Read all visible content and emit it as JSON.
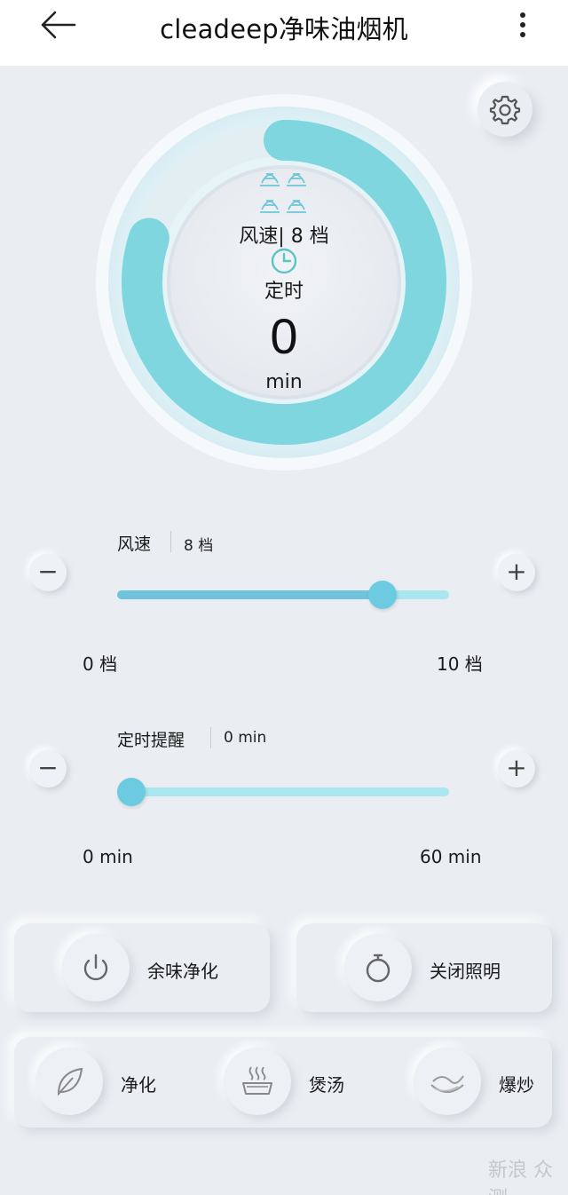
{
  "header": {
    "title": "cleadeep净味油烟机"
  },
  "dial": {
    "speed_text": "风速| 8 档",
    "timer_label": "定时",
    "timer_value": "0",
    "timer_unit": "min",
    "ring_progress": 0.8
  },
  "fan_speed": {
    "label": "风速",
    "value_text": "8 档",
    "value": 8,
    "min": 0,
    "max": 10,
    "min_label": "0 档",
    "max_label": "10 档",
    "minus": "−",
    "plus": "+"
  },
  "timer": {
    "label": "定时提醒",
    "value_text": "0 min",
    "value": 0,
    "min": 0,
    "max": 60,
    "min_label": "0 min",
    "max_label": "60 min",
    "minus": "−",
    "plus": "+"
  },
  "actions": {
    "residual_purify": "余味净化",
    "light_off": "关闭照明"
  },
  "modes": {
    "purify": "净化",
    "soup": "煲汤",
    "stir_fry": "爆炒"
  },
  "watermark": "新浪 众测",
  "colors": {
    "accent": "#7fd6df",
    "slider_fill": "#6fc3dd",
    "slider_track": "#a9e6ef",
    "background": "#eaeef3"
  }
}
